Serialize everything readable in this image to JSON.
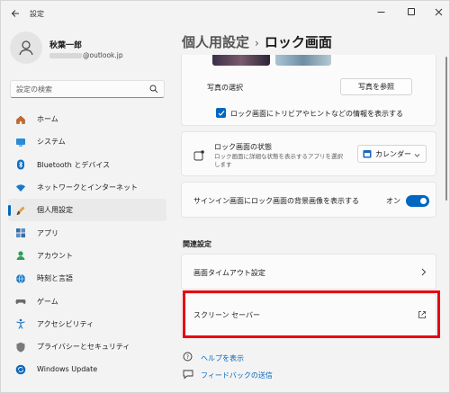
{
  "window": {
    "app_title": "設定",
    "controls": {
      "minimize": "—",
      "maximize": "",
      "close": "✕"
    }
  },
  "user": {
    "name": "秋葉一郎",
    "email_suffix": "@outlook.jp"
  },
  "search": {
    "placeholder": "設定の検索"
  },
  "sidebar": {
    "items": [
      {
        "label": "ホーム",
        "icon": "home-icon",
        "active": false
      },
      {
        "label": "システム",
        "icon": "system-icon",
        "active": false
      },
      {
        "label": "Bluetooth とデバイス",
        "icon": "bluetooth-icon",
        "active": false
      },
      {
        "label": "ネットワークとインターネット",
        "icon": "wifi-icon",
        "active": false
      },
      {
        "label": "個人用設定",
        "icon": "brush-icon",
        "active": true
      },
      {
        "label": "アプリ",
        "icon": "apps-icon",
        "active": false
      },
      {
        "label": "アカウント",
        "icon": "account-icon",
        "active": false
      },
      {
        "label": "時刻と言語",
        "icon": "globe-clock-icon",
        "active": false
      },
      {
        "label": "ゲーム",
        "icon": "gamepad-icon",
        "active": false
      },
      {
        "label": "アクセシビリティ",
        "icon": "accessibility-icon",
        "active": false
      },
      {
        "label": "プライバシーとセキュリティ",
        "icon": "shield-icon",
        "active": false
      },
      {
        "label": "Windows Update",
        "icon": "update-icon",
        "active": false
      }
    ]
  },
  "breadcrumb": {
    "parent": "個人用設定",
    "separator": "›",
    "current": "ロック画面"
  },
  "main": {
    "photo_select_label": "写真の選択",
    "browse_button": "写真を参照",
    "trivia_checkbox_label": "ロック画面にトリビアやヒントなどの情報を表示する",
    "lock_status_title": "ロック画面の状態",
    "lock_status_desc_1": "ロック画面に詳細な状態を表示するアプリを選択",
    "lock_status_desc_2": "します",
    "lock_status_value": "カレンダー",
    "signin_bg_label": "サインイン画面にロック画面の背景画像を表示する",
    "signin_bg_toggle": "オン",
    "related_title": "関連設定",
    "screen_timeout": "画面タイムアウト設定",
    "screen_saver": "スクリーン セーバー",
    "help_link": "ヘルプを表示",
    "feedback_link": "フィードバックの送信"
  },
  "colors": {
    "accent": "#0067c0",
    "highlight": "#e60012"
  }
}
